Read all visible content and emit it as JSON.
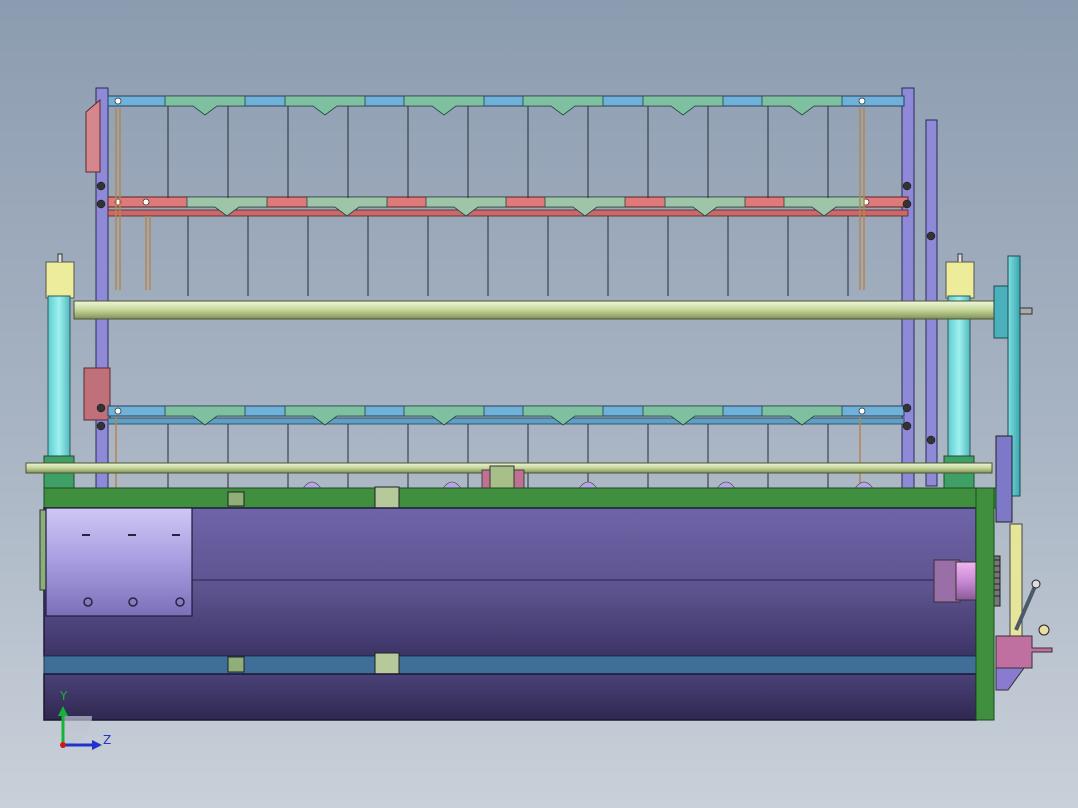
{
  "viewport": {
    "background_top": "#8c9cb0",
    "background_bottom": "#c9d0d9"
  },
  "triad": {
    "y_label": "Y",
    "z_label": "Z",
    "y_color": "#18b23a",
    "z_color": "#2233cc",
    "x_color": "#d01818"
  },
  "model": {
    "frame_color": "#8c8ad8",
    "body_color": "#655a9c",
    "base_color": "#4d4478",
    "rail_green": "#3f8f3f",
    "rail_blue": "#3f6f99",
    "upper_bar_blue": "#6fb1d8",
    "upper_bar_red": "#e07a7a",
    "shaft_color": "#c8dca0",
    "pillar_color": "#7ae0e0",
    "pillar_cap": "#e8e890",
    "motor_color": "#c888d0"
  }
}
